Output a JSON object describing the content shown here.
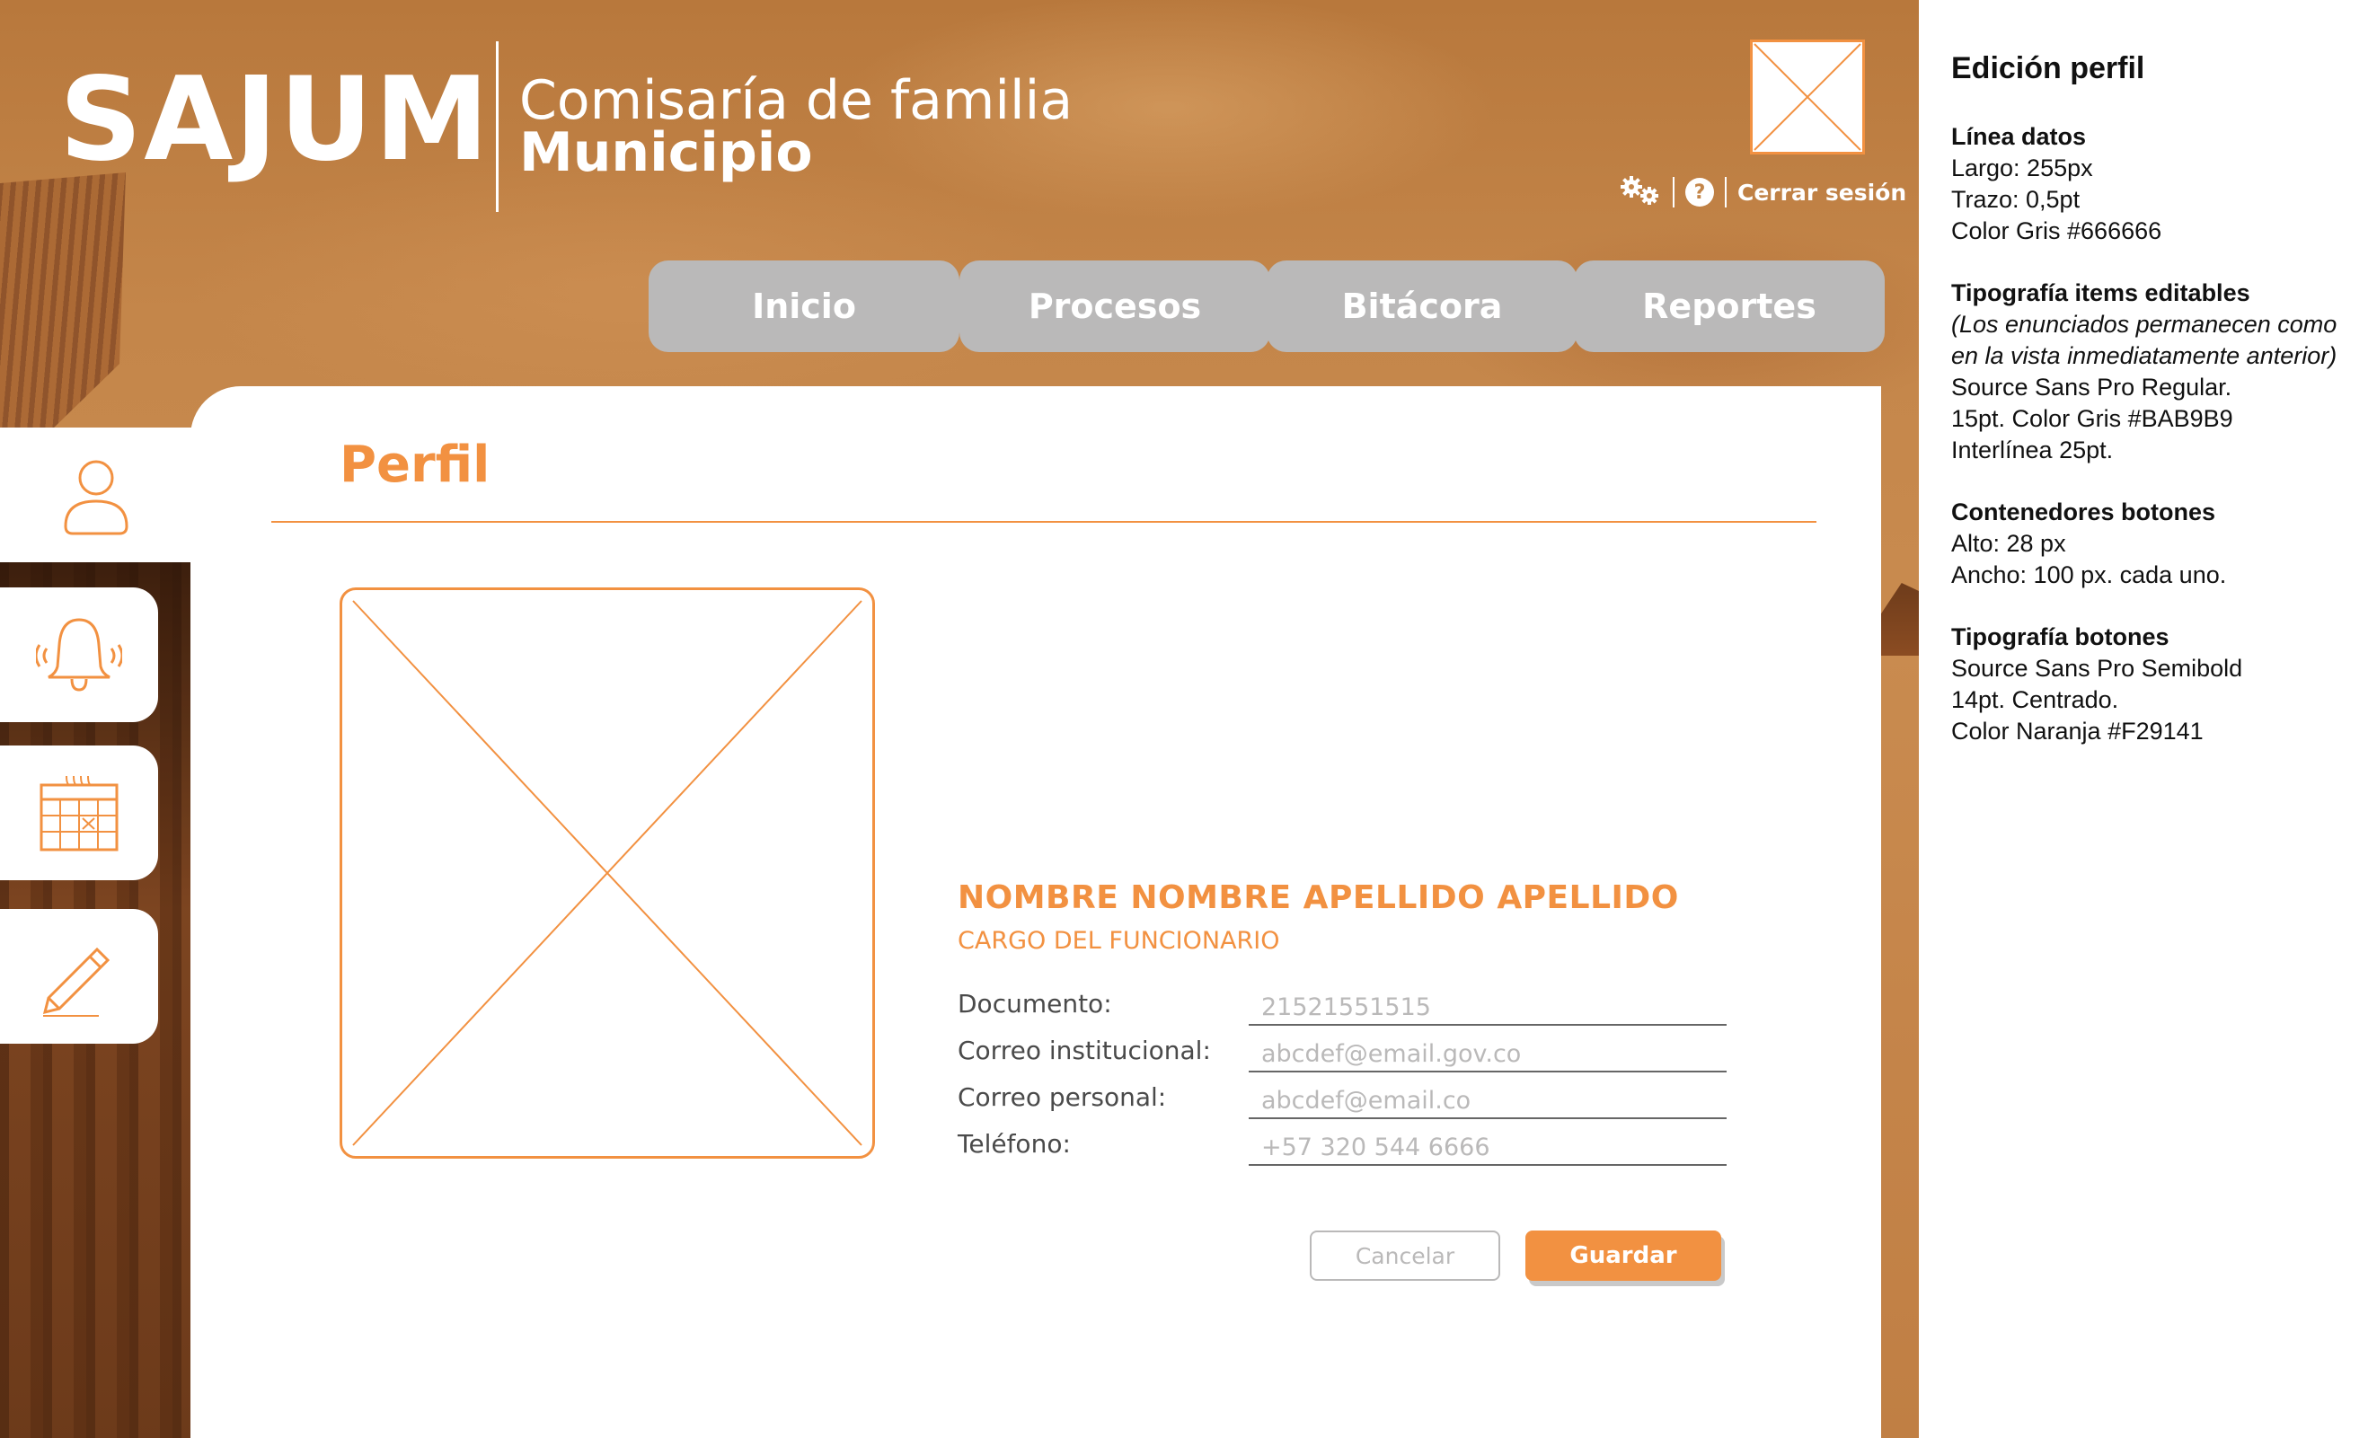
{
  "header": {
    "logo": "SAJUM",
    "org_title": "Comisaría de familia",
    "org_subtitle": "Municipio",
    "settings_icon": "gears-icon",
    "help_icon_text": "?",
    "logout_label": "Cerrar sesión"
  },
  "nav": {
    "items": [
      {
        "label": "Inicio"
      },
      {
        "label": "Procesos"
      },
      {
        "label": "Bitácora"
      },
      {
        "label": "Reportes"
      }
    ]
  },
  "sidebar": {
    "items": [
      {
        "icon": "user-icon",
        "active": true
      },
      {
        "icon": "bell-icon",
        "active": false
      },
      {
        "icon": "calendar-icon",
        "active": false
      },
      {
        "icon": "pencil-icon",
        "active": false
      }
    ]
  },
  "page": {
    "title": "Perfil",
    "photo_placeholder": "image-placeholder-icon"
  },
  "profile": {
    "name": "NOMBRE NOMBRE APELLIDO APELLIDO",
    "role": "CARGO DEL FUNCIONARIO",
    "fields": [
      {
        "label": "Documento:",
        "placeholder": "21521551515"
      },
      {
        "label": "Correo institucional:",
        "placeholder": "abcdef@email.gov.co"
      },
      {
        "label": "Correo personal:",
        "placeholder": "abcdef@email.co"
      },
      {
        "label": "Teléfono:",
        "placeholder": "+57 320 544 6666"
      }
    ]
  },
  "actions": {
    "cancel_label": "Cancelar",
    "save_label": "Guardar"
  },
  "colors": {
    "accent": "#F29141",
    "nav_gray": "#BAB9B9",
    "line_gray": "#666666"
  },
  "notes": {
    "title": "Edición perfil",
    "blocks": [
      {
        "head": "Línea datos",
        "lines": [
          "Largo: 255px",
          "Trazo: 0,5pt",
          "Color Gris #666666"
        ]
      },
      {
        "head": "Tipografía items editables",
        "italic": [
          "(Los enunciados permanecen como",
          "en la vista inmediatamente anterior)"
        ],
        "lines": [
          "Source Sans Pro Regular.",
          "15pt. Color Gris #BAB9B9",
          "Interlínea 25pt."
        ]
      },
      {
        "head": "Contenedores botones",
        "lines": [
          "Alto: 28 px",
          "Ancho: 100 px. cada uno."
        ]
      },
      {
        "head": "Tipografía botones",
        "lines": [
          "Source Sans Pro Semibold",
          "14pt. Centrado.",
          "Color Naranja #F29141"
        ]
      }
    ]
  }
}
